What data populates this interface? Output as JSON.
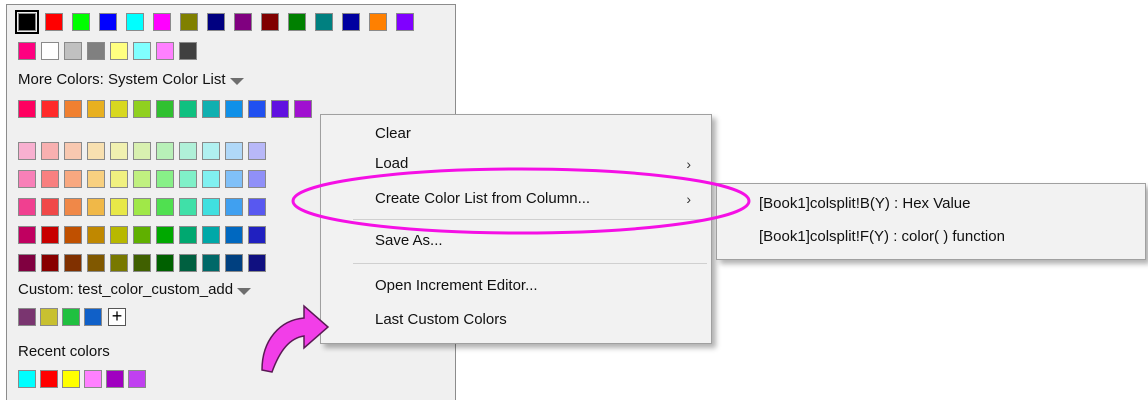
{
  "colors": {
    "highlight": "#f50fe5",
    "menu_bg": "#f2f2f2",
    "panel_bg": "#f0f0f0"
  },
  "palette": {
    "row1": [
      "#000000",
      "#ff0000",
      "#00ff00",
      "#0000ff",
      "#00ffff",
      "#ff00ff",
      "#808000",
      "#000080",
      "#800080",
      "#800000",
      "#008000",
      "#008080",
      "#0000a0",
      "#ff8000",
      "#8000ff"
    ],
    "row2": [
      "#ff0080",
      "#ffffff",
      "#c0c0c0",
      "#808080",
      "#ffff80",
      "#80ffff",
      "#ff80ff",
      "#404040"
    ],
    "more_colors_label": "More Colors: System Color List",
    "system_row": [
      "#ff0060",
      "#ff2a2a",
      "#f08030",
      "#e8b020",
      "#d8d820",
      "#90d020",
      "#30c030",
      "#10c080",
      "#10b0b0",
      "#1090e8",
      "#2050f0",
      "#6010e0",
      "#a010d0"
    ],
    "grid": [
      [
        "#f8b0d0",
        "#f8b0b0",
        "#f8c8b0",
        "#f8e0b0",
        "#f0f0b0",
        "#d8f0b0",
        "#b8f0b8",
        "#b0f0d8",
        "#b0f0f0",
        "#b0d8f8",
        "#b8b8f8"
      ],
      [
        "#f880b8",
        "#f88080",
        "#f8a880",
        "#f8d080",
        "#f0f080",
        "#c0f080",
        "#88f088",
        "#80f0c8",
        "#80f0f0",
        "#80c0f8",
        "#9090f8"
      ],
      [
        "#f04090",
        "#f04848",
        "#f08848",
        "#f0b848",
        "#e8e848",
        "#a0e848",
        "#50e050",
        "#40e0a8",
        "#40e0e0",
        "#40a0f0",
        "#5858f0"
      ],
      [
        "#c00060",
        "#c80000",
        "#c05000",
        "#c08800",
        "#b8b800",
        "#60b000",
        "#00a800",
        "#00a870",
        "#00a8a8",
        "#0068c0",
        "#2020c0"
      ],
      [
        "#800040",
        "#880000",
        "#803000",
        "#805800",
        "#787800",
        "#406000",
        "#006000",
        "#006040",
        "#006868",
        "#004080",
        "#101080"
      ]
    ],
    "custom_label": "Custom: test_color_custom_add",
    "custom": [
      "#7a3570",
      "#c8c030",
      "#20c040",
      "#1060c8"
    ],
    "recent_label": "Recent colors",
    "recent": [
      "#00ffff",
      "#ff0000",
      "#ffff00",
      "#ff80ff",
      "#a000c0",
      "#c040f0"
    ]
  },
  "context_menu": {
    "items": [
      {
        "label": "Clear"
      },
      {
        "label": "Load"
      },
      {
        "label": "Create Color List from Column..."
      },
      {
        "label": "Save As..."
      },
      {
        "label": "Open Increment Editor..."
      },
      {
        "label": "Last Custom Colors"
      }
    ],
    "chevron": "›"
  },
  "submenu": {
    "items": [
      {
        "label": "[Book1]colsplit!B(Y) : Hex Value"
      },
      {
        "label": "[Book1]colsplit!F(Y) : color( ) function"
      }
    ]
  }
}
